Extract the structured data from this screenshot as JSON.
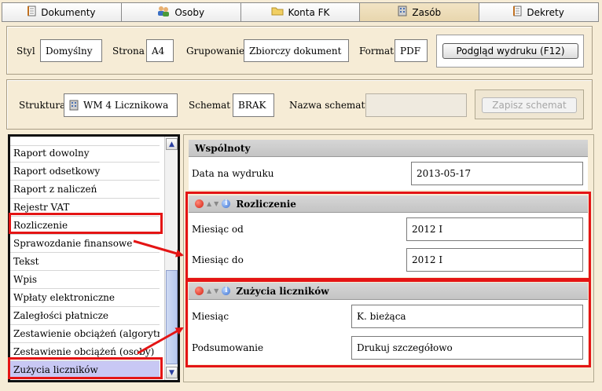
{
  "tabs": [
    {
      "label": "Dokumenty",
      "icon": "document-icon"
    },
    {
      "label": "Osoby",
      "icon": "people-icon"
    },
    {
      "label": "Konta FK",
      "icon": "folder-icon"
    },
    {
      "label": "Zasób",
      "icon": "building-icon",
      "active": true
    },
    {
      "label": "Dekrety",
      "icon": "document-icon"
    }
  ],
  "print": {
    "styl_label": "Styl",
    "styl_value": "Domyślny",
    "strona_label": "Strona",
    "strona_value": "A4",
    "grupowanie_label": "Grupowanie",
    "grupowanie_value": "Zbiorczy dokument",
    "format_label": "Format",
    "format_value": "PDF",
    "preview_button": "Podgląd wydruku (F12)"
  },
  "structure": {
    "struktura_label": "Struktura",
    "struktura_value": "WM 4 Licznikowa",
    "schemat_label": "Schemat",
    "schemat_value": "BRAK",
    "nazwa_label": "Nazwa schematu",
    "nazwa_value": "",
    "save_button": "Zapisz schemat"
  },
  "report_list": {
    "items": [
      "Raport dowolny",
      "Raport odsetkowy",
      "Raport z naliczeń",
      "Rejestr VAT",
      "Rozliczenie",
      "Sprawozdanie finansowe",
      "Tekst",
      "Wpis",
      "Wpłaty elektroniczne",
      "Zaległości płatnicze",
      "Zestawienie obciążeń (algorytmy)",
      "Zestawienie obciążeń (osoby)",
      "Zużycia liczników"
    ],
    "selected": "Zużycia liczników"
  },
  "sections": {
    "wspolnoty": {
      "title": "Wspólnoty",
      "data_label": "Data na wydruku",
      "data_value": "2013-05-17"
    },
    "rozliczenie": {
      "title": "Rozliczenie",
      "miesiac_od_label": "Miesiąc od",
      "miesiac_od_value": "2012 I",
      "miesiac_do_label": "Miesiąc do",
      "miesiac_do_value": "2012 I"
    },
    "zuzycia": {
      "title": "Zużycia liczników",
      "miesiac_label": "Miesiąc",
      "miesiac_value": "K. bieżąca",
      "podsumowanie_label": "Podsumowanie",
      "podsumowanie_value": "Drukuj szczegółowo"
    }
  },
  "colors": {
    "highlight": "#e41414",
    "selected_row": "#c8c8f4",
    "active_tab": "#e8d6ae"
  }
}
